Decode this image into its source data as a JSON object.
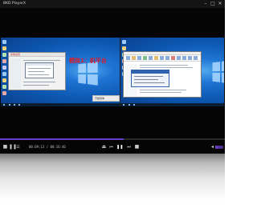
{
  "window": {
    "title": "BKD PlayerX",
    "min_glyph": "–",
    "max_glyph": "□",
    "close_glyph": "✕"
  },
  "video": {
    "left_overlay": "模拟1：机平台",
    "left_window_title": "系统设置",
    "start_menu_text": "开始菜单"
  },
  "playback": {
    "progress": 0.55,
    "time": "00:09:13 / 00:16:46"
  },
  "controls": {
    "stop_glyph": "■",
    "pause_glyph": "❚❚",
    "prev_glyph": "⏮",
    "next_glyph": "⏭",
    "eject_glyph": "⏏",
    "menu_glyph": "☰",
    "speaker_glyph": "◂"
  },
  "colors": {
    "accent": "#6a3fc8",
    "overlay_red": "#e01b24",
    "desktop_blue": "#0d58b2"
  }
}
